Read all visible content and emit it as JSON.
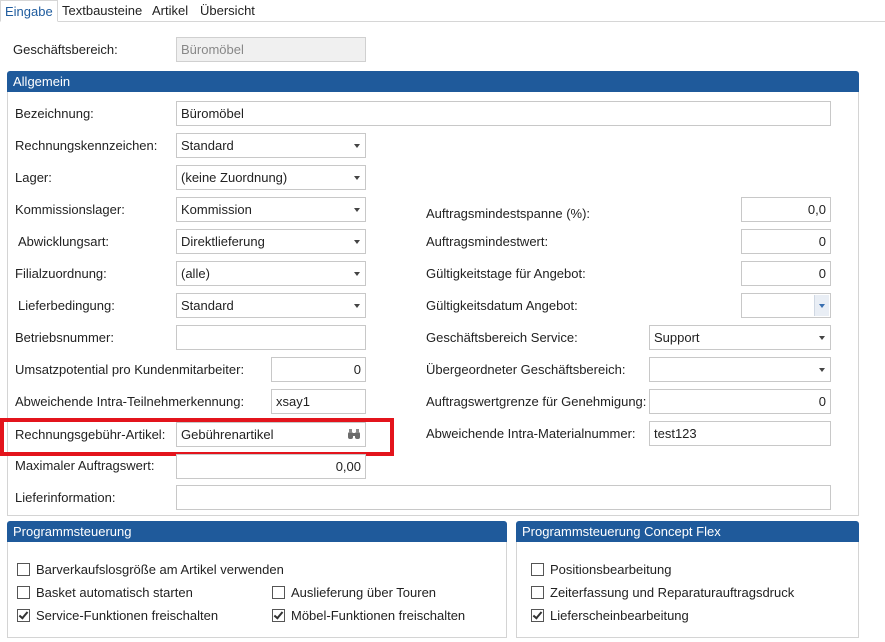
{
  "tabs": [
    "Eingabe",
    "Textbausteine",
    "Artikel",
    "Übersicht"
  ],
  "geschaeftsbereich": {
    "label": "Geschäftsbereich:",
    "value": "Büromöbel"
  },
  "allgemein": {
    "title": "Allgemein",
    "bezeichnung": {
      "label": "Bezeichnung:",
      "value": "Büromöbel"
    },
    "rechnungskennzeichen": {
      "label": "Rechnungskennzeichen:",
      "value": "Standard"
    },
    "lager": {
      "label": "Lager:",
      "value": "(keine Zuordnung)"
    },
    "kommissionslager": {
      "label": "Kommissionslager:",
      "value": "Kommission"
    },
    "abwicklungsart": {
      "label": "Abwicklungsart:",
      "value": "Direktlieferung"
    },
    "filialzuordnung": {
      "label": "Filialzuordnung:",
      "value": "(alle)"
    },
    "lieferbedingung": {
      "label": "Lieferbedingung:",
      "value": "Standard"
    },
    "betriebsnummer": {
      "label": "Betriebsnummer:",
      "value": ""
    },
    "umsatzpotential": {
      "label": "Umsatzpotential pro Kundenmitarbeiter:",
      "value": "0"
    },
    "intra_teilnehmer": {
      "label": "Abweichende Intra-Teilnehmerkennung:",
      "value": "xsay1"
    },
    "rechnungsgebuehr": {
      "label": "Rechnungsgebühr-Artikel:",
      "value": "Gebührenartikel"
    },
    "max_auftragswert": {
      "label": "Maximaler Auftragswert:",
      "value": "0,00"
    },
    "lieferinformation": {
      "label": "Lieferinformation:",
      "value": ""
    },
    "auftragsmindestspanne": {
      "label": "Auftragsmindestspanne (%):",
      "value": "0,0"
    },
    "auftragsmindestwert": {
      "label": "Auftragsmindestwert:",
      "value": "0"
    },
    "gueltigkeitstage": {
      "label": "Gültigkeitstage für Angebot:",
      "value": "0"
    },
    "gueltigkeitsdatum": {
      "label": "Gültigkeitsdatum Angebot:",
      "value": ""
    },
    "gb_service": {
      "label": "Geschäftsbereich Service:",
      "value": "Support"
    },
    "uebergeordnet": {
      "label": "Übergeordneter Geschäftsbereich:",
      "value": ""
    },
    "wertgrenze": {
      "label": "Auftragswertgrenze für Genehmigung:",
      "value": "0"
    },
    "intra_material": {
      "label": "Abweichende Intra-Materialnummer:",
      "value": "test123"
    }
  },
  "programmsteuerung": {
    "title": "Programmsteuerung",
    "items": [
      {
        "label": "Barverkaufslosgröße am Artikel verwenden",
        "checked": false
      },
      {
        "label": "Basket automatisch starten",
        "checked": false
      },
      {
        "label": "Service-Funktionen freischalten",
        "checked": true
      },
      {
        "label": "Auslieferung über Touren",
        "checked": false
      },
      {
        "label": "Möbel-Funktionen freischalten",
        "checked": true
      }
    ]
  },
  "concept_flex": {
    "title": "Programmsteuerung Concept Flex",
    "items": [
      {
        "label": "Positionsbearbeitung",
        "checked": false
      },
      {
        "label": "Zeiterfassung und Reparaturauftragsdruck",
        "checked": false
      },
      {
        "label": "Lieferscheinbearbeitung",
        "checked": true
      }
    ]
  },
  "colors": {
    "accent": "#1f5a9b",
    "highlight": "#e3141c",
    "active_tab": "#1f5c9e"
  },
  "icons": {
    "dropdown": "chevron-down-icon",
    "lookup": "binoculars-icon",
    "date": "calendar-dropdown-icon"
  }
}
